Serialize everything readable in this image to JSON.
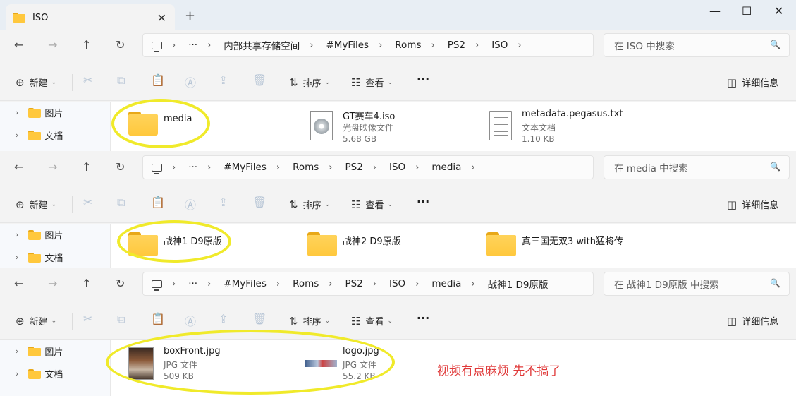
{
  "window": {
    "tab_title": "ISO",
    "new_tab": "+",
    "close_tab": "✕",
    "minimize": "—",
    "maximize": "☐",
    "close": "✕"
  },
  "toolbar": {
    "new_label": "新建",
    "sort_label": "排序",
    "view_label": "查看",
    "more_label": "···",
    "details_label": "详细信息"
  },
  "nav_items": [
    "图片",
    "文档"
  ],
  "panes": [
    {
      "breadcrumbs": [
        "···",
        "内部共享存储空间",
        "#MyFiles",
        "Roms",
        "PS2",
        "ISO"
      ],
      "search_placeholder": "在 ISO 中搜索",
      "files": [
        {
          "name": "media",
          "kind": "folder"
        },
        {
          "name": "GT赛车4.iso",
          "type": "光盘映像文件",
          "size": "5.68 GB",
          "kind": "disc"
        },
        {
          "name": "metadata.pegasus.txt",
          "type": "文本文档",
          "size": "1.10 KB",
          "kind": "text"
        }
      ]
    },
    {
      "breadcrumbs": [
        "···",
        "#MyFiles",
        "Roms",
        "PS2",
        "ISO",
        "media"
      ],
      "search_placeholder": "在 media 中搜索",
      "files": [
        {
          "name": "战神1 D9原版",
          "kind": "folder"
        },
        {
          "name": "战神2 D9原版",
          "kind": "folder"
        },
        {
          "name": "真三国无双3 with猛将传",
          "kind": "folder"
        }
      ]
    },
    {
      "breadcrumbs": [
        "···",
        "#MyFiles",
        "Roms",
        "PS2",
        "ISO",
        "media",
        "战神1 D9原版"
      ],
      "search_placeholder": "在 战神1 D9原版 中搜索",
      "files": [
        {
          "name": "boxFront.jpg",
          "type": "JPG 文件",
          "size": "509 KB",
          "kind": "image"
        },
        {
          "name": "logo.jpg",
          "type": "JPG 文件",
          "size": "55.2 KB",
          "kind": "image"
        }
      ]
    }
  ],
  "annotation": {
    "note": "视频有点麻烦 先不搞了",
    "highlight_color": "#f0ea2a",
    "note_color": "#e03a3a"
  }
}
